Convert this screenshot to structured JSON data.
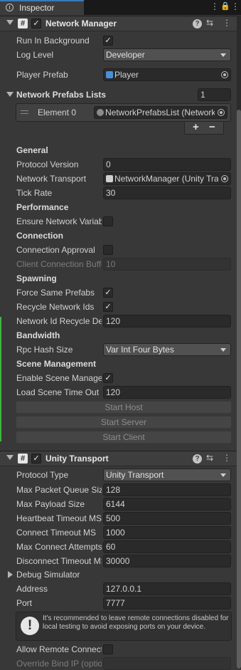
{
  "window": {
    "tab_title": "Inspector",
    "tab_icon": "info-circle-icon",
    "menu_icon": "more-vert-icon",
    "lock_icon": "lock-icon",
    "more_icon": "kebab-icon"
  },
  "network_manager": {
    "title": "Network Manager",
    "enabled": true,
    "run_in_background": {
      "label": "Run In Background",
      "checked": true
    },
    "log_level": {
      "label": "Log Level",
      "value": "Developer"
    },
    "player_prefab": {
      "label": "Player Prefab",
      "value": "Player"
    },
    "prefab_lists": {
      "label": "Network Prefabs Lists",
      "count": "1",
      "element_label": "Element 0",
      "element_value": "NetworkPrefabsList (NetworkPrefabsList)",
      "add_label": "+",
      "remove_label": "−"
    },
    "general": {
      "header": "General",
      "protocol_version": {
        "label": "Protocol Version",
        "value": "0"
      },
      "network_transport": {
        "label": "Network Transport",
        "value": "NetworkManager (Unity Transport)"
      },
      "tick_rate": {
        "label": "Tick Rate",
        "value": "30"
      }
    },
    "performance": {
      "header": "Performance",
      "ensure_network_variable": {
        "label": "Ensure Network Variable Length Safety",
        "checked": false
      }
    },
    "connection": {
      "header": "Connection",
      "connection_approval": {
        "label": "Connection Approval",
        "checked": false
      },
      "client_connection_buffer": {
        "label": "Client Connection Buffer Timeout",
        "value": "10"
      }
    },
    "spawning": {
      "header": "Spawning",
      "force_same_prefabs": {
        "label": "Force Same Prefabs",
        "checked": true
      },
      "recycle_network_ids": {
        "label": "Recycle Network Ids",
        "checked": true
      },
      "network_id_recycle_delay": {
        "label": "Network Id Recycle Delay",
        "value": "120"
      }
    },
    "bandwidth": {
      "header": "Bandwidth",
      "rpc_hash_size": {
        "label": "Rpc Hash Size",
        "value": "Var Int Four Bytes"
      }
    },
    "scene_management": {
      "header": "Scene Management",
      "enable_scene_management": {
        "label": "Enable Scene Management",
        "checked": true
      },
      "load_scene_timeout": {
        "label": "Load Scene Time Out",
        "value": "120"
      }
    },
    "buttons": {
      "start_host": "Start Host",
      "start_server": "Start Server",
      "start_client": "Start Client"
    }
  },
  "unity_transport": {
    "title": "Unity Transport",
    "enabled": true,
    "protocol_type": {
      "label": "Protocol Type",
      "value": "Unity Transport"
    },
    "max_packet_queue_size": {
      "label": "Max Packet Queue Size",
      "value": "128"
    },
    "max_payload_size": {
      "label": "Max Payload Size",
      "value": "6144"
    },
    "heartbeat_timeout": {
      "label": "Heartbeat Timeout MS",
      "value": "500"
    },
    "connect_timeout": {
      "label": "Connect Timeout MS",
      "value": "1000"
    },
    "max_connect_attempts": {
      "label": "Max Connect Attempts",
      "value": "60"
    },
    "disconnect_timeout": {
      "label": "Disconnect Timeout MS",
      "value": "30000"
    },
    "debug_simulator": {
      "label": "Debug Simulator"
    },
    "address": {
      "label": "Address",
      "value": "127.0.0.1"
    },
    "port": {
      "label": "Port",
      "value": "7777"
    },
    "info_message": "It's recommended to leave remote connections disabled for local testing to avoid exposing ports on your device.",
    "allow_remote_connections": {
      "label": "Allow Remote Connections?",
      "checked": false
    },
    "override_bind_ip": {
      "label": "Override Bind IP (optional)"
    }
  },
  "colors": {
    "background": "#383838",
    "field_bg": "#2a2a2a",
    "header_bg": "#3e3e3e",
    "tab_accent": "#3a79bb",
    "play_mode_indicator": "#41b441"
  }
}
